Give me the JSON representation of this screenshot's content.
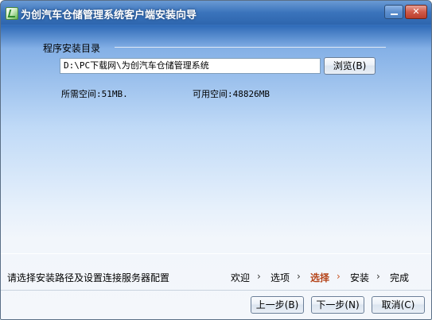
{
  "window": {
    "title": "为创汽车仓储管理系统客户端安装向导",
    "minimize_label": "",
    "close_label": "✕"
  },
  "install_dir": {
    "label": "程序安装目录",
    "path": "D:\\PC下载网\\为创汽车仓储管理系统",
    "browse_label": "浏览(B)"
  },
  "space": {
    "required": "所需空间:51MB.",
    "available": "可用空间:48826MB"
  },
  "status": {
    "hint": "请选择安装路径及设置连接服务器配置"
  },
  "steps": [
    {
      "label": "欢迎"
    },
    {
      "label": "选项"
    },
    {
      "label": "选择"
    },
    {
      "label": "安装"
    },
    {
      "label": "完成"
    }
  ],
  "step_separator": "›",
  "active_step": "选择",
  "buttons": {
    "prev": "上一步(B)",
    "next": "下一步(N)",
    "cancel": "取消(C)"
  },
  "colors": {
    "title_bar": "#3a73bb",
    "active_step": "#b5451b"
  }
}
